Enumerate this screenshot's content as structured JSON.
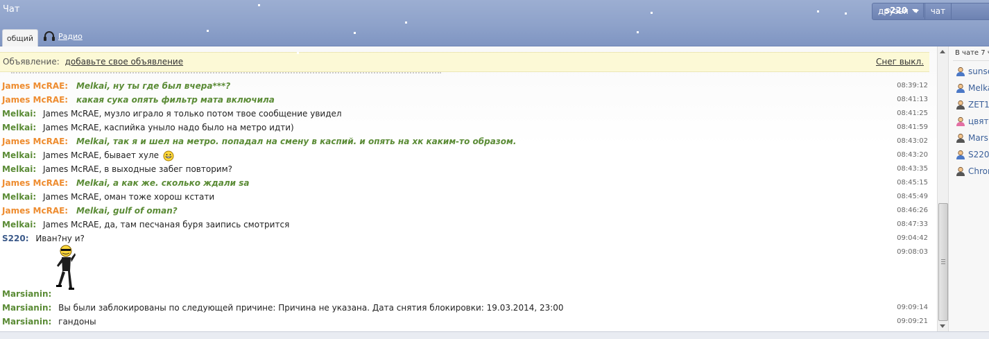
{
  "header": {
    "title": "Чат",
    "menu": {
      "user": "s220",
      "friends": "друзья",
      "chat": "чат"
    },
    "tabs": {
      "active": "общий",
      "radio": "Радио"
    }
  },
  "announcement": {
    "prefix": "Объявление:",
    "link": "добавьте свое объявление",
    "snow_toggle": "Снег выкл."
  },
  "messages": [
    {
      "nick": "James McRAE:",
      "text": "Melkai, ну ты где был вчера***?",
      "time": "08:39:12"
    },
    {
      "nick": "James McRAE:",
      "text": "какая сука опять фильтр мата включила",
      "time": "08:41:13"
    },
    {
      "nick": "Melkai:",
      "text": "James McRAE, музло играло я только потом твое сообщение увидел",
      "time": "08:41:25"
    },
    {
      "nick": "Melkai:",
      "text": "James McRAE, каспийка уныло надо было на метро идти)",
      "time": "08:41:59"
    },
    {
      "nick": "James McRAE:",
      "text": "Melkai, так я и шел на метро. попадал на смену в каспий. и опять на хк каким-то образом.",
      "time": "08:43:02"
    },
    {
      "nick": "Melkai:",
      "text": "James McRAE, бывает хуле",
      "time": "08:43:20"
    },
    {
      "nick": "Melkai:",
      "text": "James McRAE, в выходные забег повторим?",
      "time": "08:43:35"
    },
    {
      "nick": "James McRAE:",
      "text": "Melkai, а как же. сколько ждали sa",
      "time": "08:45:15"
    },
    {
      "nick": "Melkai:",
      "text": "James McRAE, оман тоже хорош кстати",
      "time": "08:45:49"
    },
    {
      "nick": "James McRAE:",
      "text": "Melkai, gulf of oman?",
      "time": "08:46:26"
    },
    {
      "nick": "Melkai:",
      "text": "James McRAE, да, там песчаная буря заипись смотрится",
      "time": "08:47:33"
    },
    {
      "nick": "S220:",
      "text": "Иван?ну и?",
      "time": "09:04:42"
    },
    {
      "nick": "Marsianin:",
      "text": "",
      "time": "09:08:03"
    },
    {
      "nick": "Marsianin:",
      "text": "Вы были заблокированы по следующей причине: Причина не указана. Дата снятия блокировки: 19.03.2014, 23:00",
      "time": "09:09:14"
    },
    {
      "nick": "Marsianin:",
      "text": "гандоны",
      "time": "09:09:21"
    }
  ],
  "users_panel": {
    "count_label": "В чате 7 ч",
    "users": [
      "sunse",
      "Melka",
      "ZET1",
      "цвято",
      "Mars",
      "S220",
      "Chron"
    ]
  },
  "colors": {
    "header_bg": "#8ea2ca",
    "nick_orange": "#ee8c2f",
    "nick_green": "#5a8b35",
    "announce_bg": "#fcf9d6"
  }
}
